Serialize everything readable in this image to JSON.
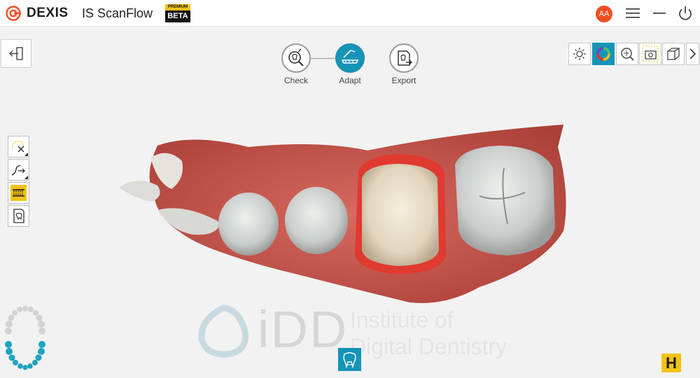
{
  "app": {
    "brand": "DEXIS",
    "product": "IS ScanFlow",
    "tier_top": "PREMIUM",
    "tier_badge": "BETA",
    "user_initials": "AA"
  },
  "workflow": {
    "steps": [
      {
        "label": "Check",
        "icon": "tooth-check-icon",
        "active": false
      },
      {
        "label": "Adapt",
        "icon": "adapt-icon",
        "active": true
      },
      {
        "label": "Export",
        "icon": "export-icon",
        "active": false
      }
    ]
  },
  "right_toolbar": [
    {
      "icon": "brightness-icon",
      "active": false
    },
    {
      "icon": "color-wheel-icon",
      "active": true
    },
    {
      "icon": "zoom-icon",
      "active": false
    },
    {
      "icon": "snapshot-icon",
      "active": false
    },
    {
      "icon": "3d-view-icon",
      "active": false
    }
  ],
  "left_toolbar": [
    {
      "icon": "trim-tool-icon"
    },
    {
      "icon": "margin-line-icon"
    },
    {
      "icon": "bite-view-icon"
    },
    {
      "icon": "tooth-report-icon"
    }
  ],
  "watermark": {
    "idd": "iDD",
    "line1": "Institute of",
    "line2": "Digital Dentistry"
  },
  "badge_h": "H",
  "colors": {
    "accent": "#1694b8",
    "avatar": "#f04e23",
    "beta_yellow": "#f2c315",
    "gum": "#c9473f",
    "prep": "#e8352e"
  }
}
